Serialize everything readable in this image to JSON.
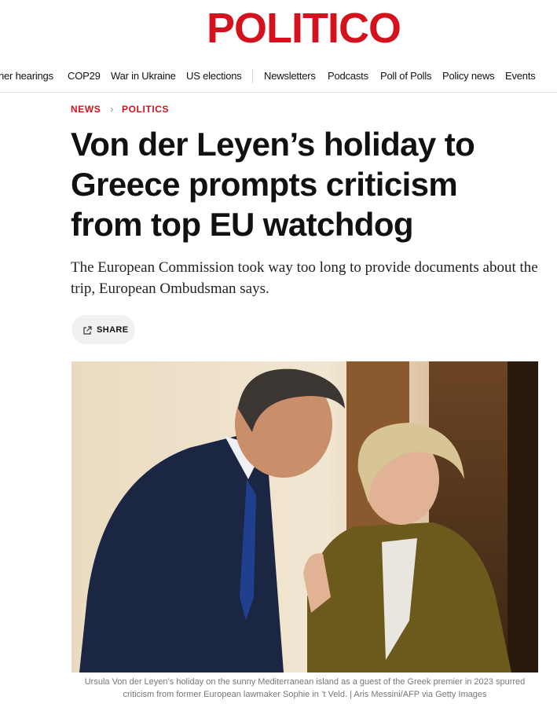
{
  "brand": {
    "logo_text": "POLITICO",
    "accent_color": "#d3121d"
  },
  "nav": {
    "left_items": [
      "ner hearings",
      "COP29",
      "War in Ukraine",
      "US elections"
    ],
    "right_items": [
      "Newsletters",
      "Podcasts",
      "Poll of Polls",
      "Policy news",
      "Events"
    ]
  },
  "breadcrumb": {
    "items": [
      "NEWS",
      "POLITICS"
    ]
  },
  "article": {
    "headline": "Von der Leyen’s holiday to Greece prompts criticism from top EU watchdog",
    "dek": "The European Commission took way too long to provide documents about the trip, European Ombudsman says.",
    "share_label": "SHARE",
    "share_icon": "share-icon",
    "image_caption": "Ursula Von der Leyen’s holiday on the sunny Mediterranean island as a guest of the Greek premier in 2023 spurred criticism from former European lawmaker Sophie in ’t Veld. | Aris Messini/AFP via Getty Images"
  }
}
